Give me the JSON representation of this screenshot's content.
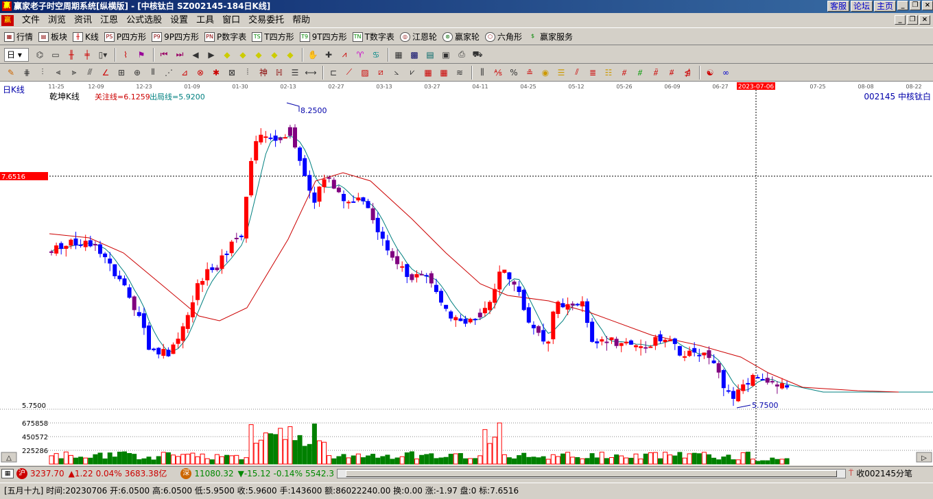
{
  "window": {
    "title": "赢家老子时空周期系统[纵横版] - [中核钛白   SZ002145-184日K线]",
    "top_buttons": [
      "客服",
      "论坛",
      "主页"
    ]
  },
  "menu": [
    "文件",
    "浏览",
    "资讯",
    "江恩",
    "公式选股",
    "设置",
    "工具",
    "窗口",
    "交易委托",
    "帮助"
  ],
  "toolbar1": [
    {
      "label": "行情",
      "icon": "grid-icon"
    },
    {
      "label": "板块",
      "icon": "blocks-icon"
    },
    {
      "label": "K线",
      "icon": "kline-icon"
    },
    {
      "label": "P四方形",
      "icon": "ps-icon",
      "tag": "PS"
    },
    {
      "label": "9P四方形",
      "icon": "p9-icon",
      "tag": "P9"
    },
    {
      "label": "P数字表",
      "icon": "pn-icon",
      "tag": "PN"
    },
    {
      "label": "T四方形",
      "icon": "ts-icon",
      "tag": "TS"
    },
    {
      "label": "9T四方形",
      "icon": "t9-icon",
      "tag": "T9"
    },
    {
      "label": "T数字表",
      "icon": "tn-icon",
      "tag": "TN"
    },
    {
      "label": "江恩轮",
      "icon": "gann-wheel-icon"
    },
    {
      "label": "赢家轮",
      "icon": "winner-wheel-icon"
    },
    {
      "label": "六角形",
      "icon": "hexagon-icon"
    },
    {
      "label": "赢家服务",
      "icon": "service-icon"
    }
  ],
  "period_select": "日",
  "chart": {
    "left_label": "日K线",
    "indicator_name": "乾坤K线",
    "focus_line": "关注线=6.1259",
    "exit_line": "出局线=5.9200",
    "stock_label": "002145  中核钛白",
    "crosshair_price": "7.6516",
    "crosshair_date": "2023-07-06",
    "high_label": "8.2500",
    "low_label": "5.7500",
    "price_axis": [
      "5.7500"
    ],
    "volume_axis": [
      "675858",
      "450572",
      "225286"
    ],
    "dates": [
      "11-25",
      "12-09",
      "12-23",
      "01-09",
      "01-30",
      "02-13",
      "02-27",
      "03-13",
      "03-27",
      "04-11",
      "04-25",
      "05-12",
      "05-26",
      "06-09",
      "06-27",
      "07-25",
      "08-08",
      "08-22"
    ],
    "colors": {
      "up": "#ff0000",
      "down": "#0000ff",
      "purple": "#800080",
      "ma_red": "#cc0000",
      "ma_teal": "#008080"
    }
  },
  "index_bar": {
    "sh_badge": "沪",
    "sh_value": "3237.70",
    "sh_change": "▲1.22",
    "sh_pct": "0.04%",
    "sh_amount": "3683.38亿",
    "sz_badge": "深",
    "sz_value": "11080.32",
    "sz_change": "▼-15.12",
    "sz_pct": "-0.14%",
    "sz_amount": "5542.3",
    "right_text": "收002145分笔"
  },
  "status_bar": "[五月十九] 时间:20230706 开:6.0500 高:6.0500 低:5.9500 收:5.9600 手:143600 额:86022240.00 换:0.00 涨:-1.97 盘:0 标:7.6516"
}
